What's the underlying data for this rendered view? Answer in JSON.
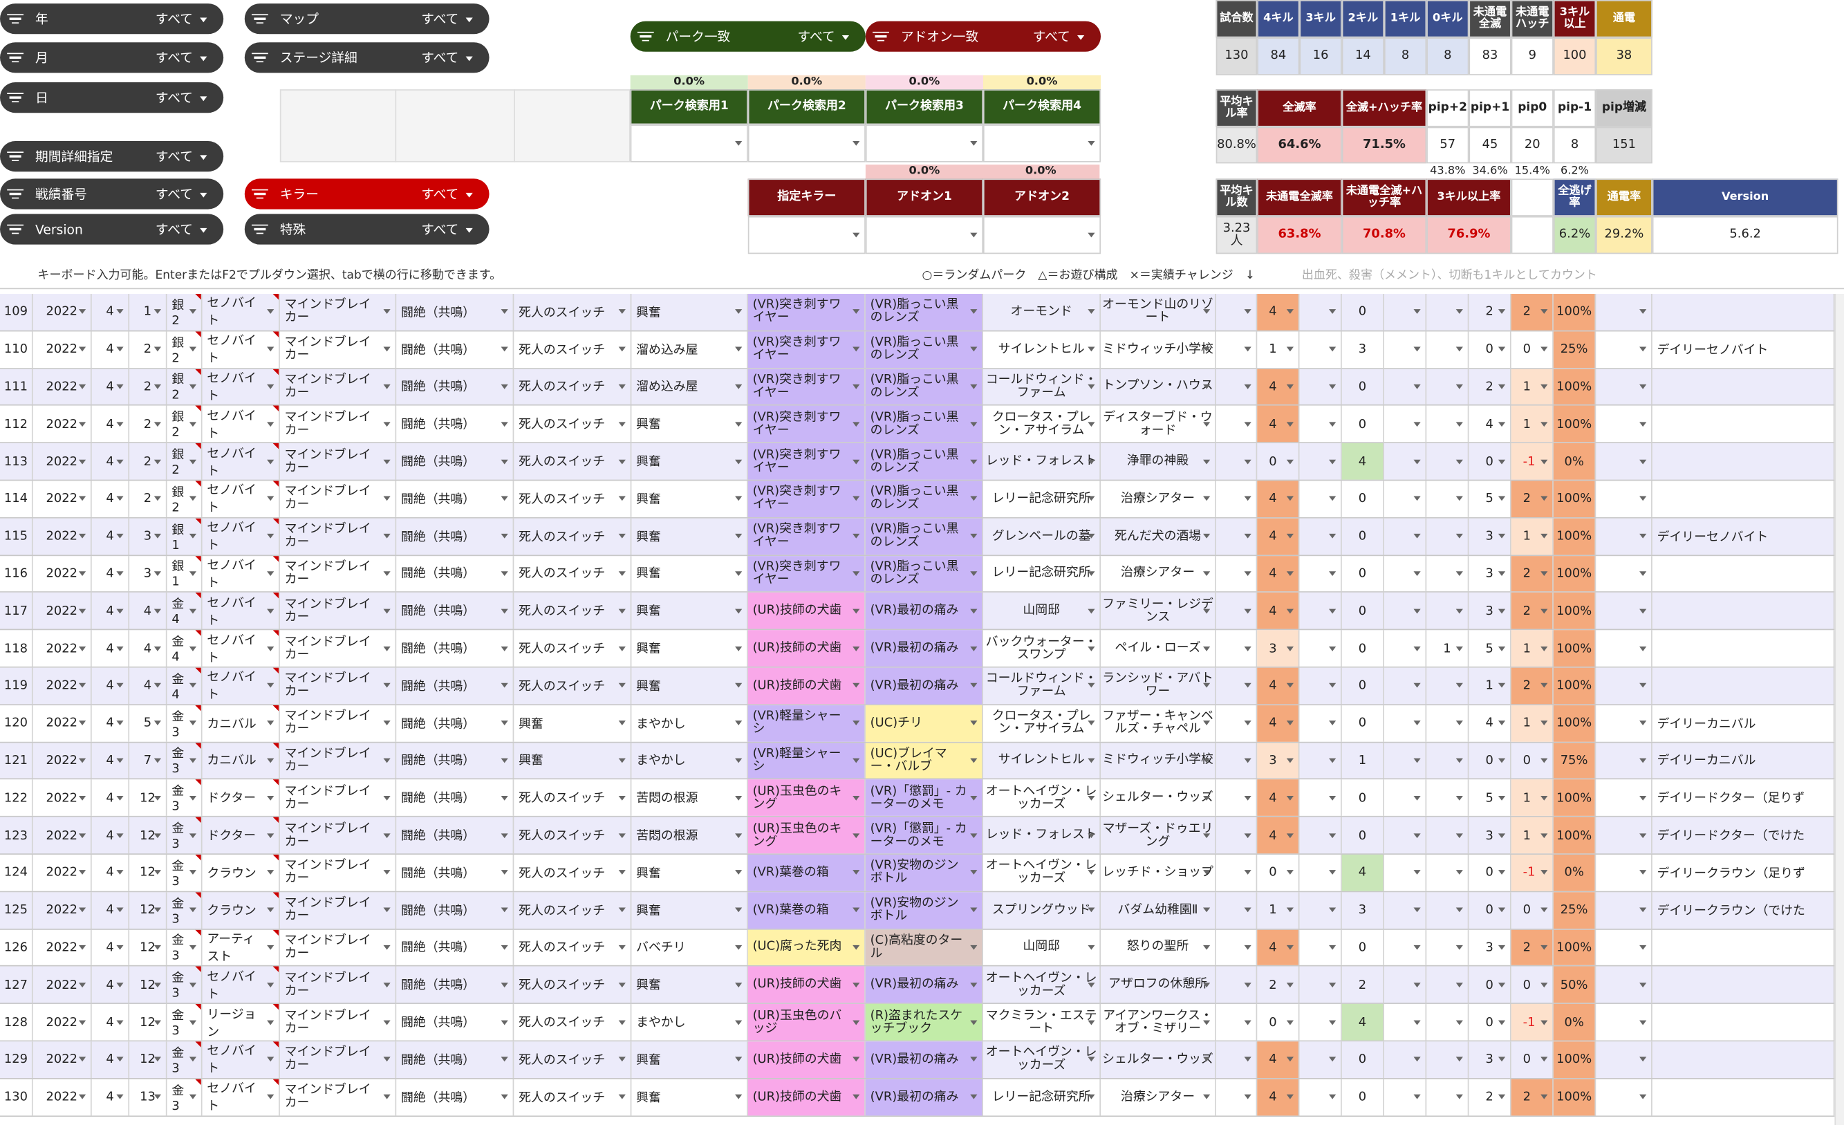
{
  "filters": {
    "year": {
      "label": "年",
      "value": "すべて"
    },
    "month": {
      "label": "月",
      "value": "すべて"
    },
    "day": {
      "label": "日",
      "value": "すべて"
    },
    "period": {
      "label": "期間詳細指定",
      "value": "すべて"
    },
    "battle_no": {
      "label": "戦績番号",
      "value": "すべて"
    },
    "version": {
      "label": "Version",
      "value": "すべて"
    },
    "map": {
      "label": "マップ",
      "value": "すべて"
    },
    "stage": {
      "label": "ステージ詳細",
      "value": "すべて"
    },
    "killer": {
      "label": "キラー",
      "value": "すべて"
    },
    "special": {
      "label": "特殊",
      "value": "すべて"
    },
    "perk_match": {
      "label": "パーク一致",
      "value": "すべて"
    },
    "addon_match": {
      "label": "アドオン一致",
      "value": "すべて"
    }
  },
  "perk_search": {
    "pcts": [
      "0.0%",
      "0.0%",
      "0.0%",
      "0.0%"
    ],
    "headers": [
      "パーク検索用1",
      "パーク検索用2",
      "パーク検索用3",
      "パーク検索用4"
    ]
  },
  "killer_search": {
    "pcts": [
      "0.0%",
      "0.0%"
    ],
    "headers": [
      "指定キラー",
      "アドオン1",
      "アドオン2"
    ]
  },
  "stats1": {
    "headers": [
      "試合数",
      "4キル",
      "3キル",
      "2キル",
      "1キル",
      "0キル",
      "未通電全滅",
      "未通電ハッチ",
      "3キル以上",
      "通電"
    ],
    "values": [
      "130",
      "84",
      "16",
      "14",
      "8",
      "8",
      "83",
      "9",
      "100",
      "38"
    ]
  },
  "stats2": {
    "headers": [
      "平均キル率",
      "全滅率",
      "全滅+ハッチ率",
      "pip+2",
      "pip+1",
      "pip0",
      "pip-1",
      "pip増減"
    ],
    "values": [
      "80.8%",
      "64.6%",
      "71.5%",
      "57",
      "45",
      "20",
      "8",
      "151"
    ],
    "sub": [
      "43.8%",
      "34.6%",
      "15.4%",
      "6.2%"
    ]
  },
  "stats3": {
    "headers": [
      "平均キル数",
      "未通電全滅率",
      "未通電全滅+ハッチ率",
      "3キル以上率",
      "",
      "全逃げ率",
      "通電率",
      "Version"
    ],
    "values": [
      "3.23人",
      "63.8%",
      "70.8%",
      "76.9%",
      "",
      "6.2%",
      "29.2%",
      "5.6.2"
    ]
  },
  "hint": "キーボード入力可能。EnterまたはF2でプルダウン選択、tabで横の行に移動できます。",
  "legend": "○＝ランダムパーク　△＝お遊び構成　×＝実績チャレンジ　↓",
  "note": "出血死、殺害（メメント）、切断も1キルとしてカウント",
  "rows": [
    {
      "n": "109",
      "y": "2022",
      "m": "4",
      "d": "1",
      "rk": "銀2",
      "k": "セノバイト",
      "p1": "マインドブレイカー",
      "p2": "闘絶（共鳴）",
      "p3": "死人のスイッチ",
      "p4": "興奮",
      "a1": "(VR)突き刺すワイヤー",
      "a1c": "lav",
      "a2": "(VR)脂っこい黒のレンズ",
      "a2c": "lav",
      "mp": "オーモンド",
      "st": "オーモンド山のリゾート",
      "k4": "4",
      "k4c": "org",
      "e": "0",
      "e2": "",
      "pp": "2",
      "pip": "2",
      "pipc": "org",
      "pct": "100%",
      "ver": ""
    },
    {
      "n": "110",
      "y": "2022",
      "m": "4",
      "d": "2",
      "rk": "銀2",
      "k": "セノバイト",
      "p1": "マインドブレイカー",
      "p2": "闘絶（共鳴）",
      "p3": "死人のスイッチ",
      "p4": "溜め込み屋",
      "a1": "(VR)突き刺すワイヤー",
      "a1c": "lav",
      "a2": "(VR)脂っこい黒のレンズ",
      "a2c": "lav",
      "mp": "サイレントヒル",
      "st": "ミドウィッチ小学校",
      "k4": "1",
      "k4c": "",
      "e": "3",
      "e2": "",
      "pp": "0",
      "pip": "0",
      "pipc": "",
      "pct": "25%",
      "ver": "デイリーセノバイト"
    },
    {
      "n": "111",
      "y": "2022",
      "m": "4",
      "d": "2",
      "rk": "銀2",
      "k": "セノバイト",
      "p1": "マインドブレイカー",
      "p2": "闘絶（共鳴）",
      "p3": "死人のスイッチ",
      "p4": "溜め込み屋",
      "a1": "(VR)突き刺すワイヤー",
      "a1c": "lav",
      "a2": "(VR)脂っこい黒のレンズ",
      "a2c": "lav",
      "mp": "コールドウィンド・ファーム",
      "st": "トンプソン・ハウス",
      "k4": "4",
      "k4c": "org",
      "e": "0",
      "e2": "",
      "pp": "2",
      "pip": "1",
      "pipc": "lorg",
      "pct": "100%",
      "ver": ""
    },
    {
      "n": "112",
      "y": "2022",
      "m": "4",
      "d": "2",
      "rk": "銀2",
      "k": "セノバイト",
      "p1": "マインドブレイカー",
      "p2": "闘絶（共鳴）",
      "p3": "死人のスイッチ",
      "p4": "興奮",
      "a1": "(VR)突き刺すワイヤー",
      "a1c": "lav",
      "a2": "(VR)脂っこい黒のレンズ",
      "a2c": "lav",
      "mp": "クロータス・プレン・アサイラム",
      "st": "ディスターブド・ウォード",
      "k4": "4",
      "k4c": "org",
      "e": "0",
      "e2": "",
      "pp": "4",
      "pip": "1",
      "pipc": "lorg",
      "pct": "100%",
      "ver": ""
    },
    {
      "n": "113",
      "y": "2022",
      "m": "4",
      "d": "2",
      "rk": "銀2",
      "k": "セノバイト",
      "p1": "マインドブレイカー",
      "p2": "闘絶（共鳴）",
      "p3": "死人のスイッチ",
      "p4": "興奮",
      "a1": "(VR)突き刺すワイヤー",
      "a1c": "lav",
      "a2": "(VR)脂っこい黒のレンズ",
      "a2c": "lav",
      "mp": "レッド・フォレスト",
      "st": "浄罪の神殿",
      "k4": "0",
      "k4c": "",
      "e": "4",
      "e2": "lgrn",
      "pp": "0",
      "pip": "-1",
      "pipc": "lorg rn",
      "pct": "0%",
      "ver": ""
    },
    {
      "n": "114",
      "y": "2022",
      "m": "4",
      "d": "2",
      "rk": "銀2",
      "k": "セノバイト",
      "p1": "マインドブレイカー",
      "p2": "闘絶（共鳴）",
      "p3": "死人のスイッチ",
      "p4": "興奮",
      "a1": "(VR)突き刺すワイヤー",
      "a1c": "lav",
      "a2": "(VR)脂っこい黒のレンズ",
      "a2c": "lav",
      "mp": "レリー記念研究所",
      "st": "治療シアター",
      "k4": "4",
      "k4c": "org",
      "e": "0",
      "e2": "",
      "pp": "5",
      "pip": "2",
      "pipc": "org",
      "pct": "100%",
      "ver": ""
    },
    {
      "n": "115",
      "y": "2022",
      "m": "4",
      "d": "3",
      "rk": "銀1",
      "k": "セノバイト",
      "p1": "マインドブレイカー",
      "p2": "闘絶（共鳴）",
      "p3": "死人のスイッチ",
      "p4": "興奮",
      "a1": "(VR)突き刺すワイヤー",
      "a1c": "lav",
      "a2": "(VR)脂っこい黒のレンズ",
      "a2c": "lav",
      "mp": "グレンベールの墓",
      "st": "死んだ犬の酒場",
      "k4": "4",
      "k4c": "org",
      "e": "0",
      "e2": "",
      "pp": "3",
      "pip": "1",
      "pipc": "lorg",
      "pct": "100%",
      "ver": "デイリーセノバイト"
    },
    {
      "n": "116",
      "y": "2022",
      "m": "4",
      "d": "3",
      "rk": "銀1",
      "k": "セノバイト",
      "p1": "マインドブレイカー",
      "p2": "闘絶（共鳴）",
      "p3": "死人のスイッチ",
      "p4": "興奮",
      "a1": "(VR)突き刺すワイヤー",
      "a1c": "lav",
      "a2": "(VR)脂っこい黒のレンズ",
      "a2c": "lav",
      "mp": "レリー記念研究所",
      "st": "治療シアター",
      "k4": "4",
      "k4c": "org",
      "e": "0",
      "e2": "",
      "pp": "3",
      "pip": "2",
      "pipc": "org",
      "pct": "100%",
      "ver": ""
    },
    {
      "n": "117",
      "y": "2022",
      "m": "4",
      "d": "4",
      "rk": "金4",
      "k": "セノバイト",
      "p1": "マインドブレイカー",
      "p2": "闘絶（共鳴）",
      "p3": "死人のスイッチ",
      "p4": "興奮",
      "a1": "(UR)技師の犬歯",
      "a1c": "pink",
      "a2": "(VR)最初の痛み",
      "a2c": "lav",
      "mp": "山岡邸",
      "st": "ファミリー・レジデンス",
      "k4": "4",
      "k4c": "org",
      "e": "0",
      "e2": "",
      "pp": "3",
      "pip": "2",
      "pipc": "org",
      "pct": "100%",
      "ver": ""
    },
    {
      "n": "118",
      "y": "2022",
      "m": "4",
      "d": "4",
      "rk": "金4",
      "k": "セノバイト",
      "p1": "マインドブレイカー",
      "p2": "闘絶（共鳴）",
      "p3": "死人のスイッチ",
      "p4": "興奮",
      "a1": "(UR)技師の犬歯",
      "a1c": "pink",
      "a2": "(VR)最初の痛み",
      "a2c": "lav",
      "mp": "バックウォーター・スワンプ",
      "st": "ペイル・ローズ",
      "k4": "3",
      "k4c": "lorg",
      "e": "0",
      "e2": "",
      "e3": "1",
      "pp": "5",
      "pip": "1",
      "pipc": "lorg",
      "pct": "100%",
      "ver": ""
    },
    {
      "n": "119",
      "y": "2022",
      "m": "4",
      "d": "4",
      "rk": "金4",
      "k": "セノバイト",
      "p1": "マインドブレイカー",
      "p2": "闘絶（共鳴）",
      "p3": "死人のスイッチ",
      "p4": "興奮",
      "a1": "(UR)技師の犬歯",
      "a1c": "pink",
      "a2": "(VR)最初の痛み",
      "a2c": "lav",
      "mp": "コールドウィンド・ファーム",
      "st": "ランシッド・アバトワー",
      "k4": "4",
      "k4c": "org",
      "e": "0",
      "e2": "",
      "pp": "1",
      "pip": "2",
      "pipc": "org",
      "pct": "100%",
      "ver": ""
    },
    {
      "n": "120",
      "y": "2022",
      "m": "4",
      "d": "5",
      "rk": "金3",
      "k": "カニバル",
      "p1": "マインドブレイカー",
      "p2": "闘絶（共鳴）",
      "p3": "興奮",
      "p4": "まやかし",
      "a1": "(VR)軽量シャーシ",
      "a1c": "lav",
      "a2": "(UC)チリ",
      "a2c": "ylw",
      "mp": "クロータス・プレン・アサイラム",
      "st": "ファザー・キャンベルズ・チャペル",
      "k4": "4",
      "k4c": "org",
      "e": "0",
      "e2": "",
      "pp": "4",
      "pip": "1",
      "pipc": "lorg",
      "pct": "100%",
      "ver": "デイリーカニバル"
    },
    {
      "n": "121",
      "y": "2022",
      "m": "4",
      "d": "7",
      "rk": "金3",
      "k": "カニバル",
      "p1": "マインドブレイカー",
      "p2": "闘絶（共鳴）",
      "p3": "興奮",
      "p4": "まやかし",
      "a1": "(VR)軽量シャーシ",
      "a1c": "lav",
      "a2": "(UC)ブレイマー・バルブ",
      "a2c": "ylw",
      "mp": "サイレントヒル",
      "st": "ミドウィッチ小学校",
      "k4": "3",
      "k4c": "lorg",
      "e": "1",
      "e2": "",
      "pp": "0",
      "pip": "0",
      "pipc": "",
      "pct": "75%",
      "ver": "デイリーカニバル"
    },
    {
      "n": "122",
      "y": "2022",
      "m": "4",
      "d": "12",
      "rk": "金3",
      "k": "ドクター",
      "p1": "マインドブレイカー",
      "p2": "闘絶（共鳴）",
      "p3": "死人のスイッチ",
      "p4": "苦悶の根源",
      "a1": "(UR)玉虫色のキング",
      "a1c": "pink",
      "a2": "(VR)「懲罰」- カーターのメモ",
      "a2c": "lav",
      "mp": "オートヘイヴン・レッカーズ",
      "st": "シェルター・ウッズ",
      "k4": "4",
      "k4c": "org",
      "e": "0",
      "e2": "",
      "pp": "5",
      "pip": "1",
      "pipc": "lorg",
      "pct": "100%",
      "ver": "デイリードクター（足りず"
    },
    {
      "n": "123",
      "y": "2022",
      "m": "4",
      "d": "12",
      "rk": "金3",
      "k": "ドクター",
      "p1": "マインドブレイカー",
      "p2": "闘絶（共鳴）",
      "p3": "死人のスイッチ",
      "p4": "苦悶の根源",
      "a1": "(UR)玉虫色のキング",
      "a1c": "pink",
      "a2": "(VR)「懲罰」- カーターのメモ",
      "a2c": "lav",
      "mp": "レッド・フォレスト",
      "st": "マザーズ・ドゥエリング",
      "k4": "4",
      "k4c": "org",
      "e": "0",
      "e2": "",
      "pp": "3",
      "pip": "1",
      "pipc": "lorg",
      "pct": "100%",
      "ver": "デイリードクター（でけた"
    },
    {
      "n": "124",
      "y": "2022",
      "m": "4",
      "d": "12",
      "rk": "金3",
      "k": "クラウン",
      "p1": "マインドブレイカー",
      "p2": "闘絶（共鳴）",
      "p3": "死人のスイッチ",
      "p4": "興奮",
      "a1": "(VR)葉巻の箱",
      "a1c": "lav",
      "a2": "(VR)安物のジンボトル",
      "a2c": "lav",
      "mp": "オートヘイヴン・レッカーズ",
      "st": "レッチド・ショップ",
      "k4": "0",
      "k4c": "",
      "e": "4",
      "e2": "lgrn",
      "pp": "0",
      "pip": "-1",
      "pipc": "lorg rn",
      "pct": "0%",
      "ver": "デイリークラウン（足りず"
    },
    {
      "n": "125",
      "y": "2022",
      "m": "4",
      "d": "12",
      "rk": "金3",
      "k": "クラウン",
      "p1": "マインドブレイカー",
      "p2": "闘絶（共鳴）",
      "p3": "死人のスイッチ",
      "p4": "興奮",
      "a1": "(VR)葉巻の箱",
      "a1c": "lav",
      "a2": "(VR)安物のジンボトル",
      "a2c": "lav",
      "mp": "スプリングウッド",
      "st": "バダム幼稚園Ⅱ",
      "k4": "1",
      "k4c": "",
      "e": "3",
      "e2": "",
      "pp": "0",
      "pip": "0",
      "pipc": "",
      "pct": "25%",
      "ver": "デイリークラウン（でけた"
    },
    {
      "n": "126",
      "y": "2022",
      "m": "4",
      "d": "12",
      "rk": "金3",
      "k": "アーティスト",
      "p1": "マインドブレイカー",
      "p2": "闘絶（共鳴）",
      "p3": "死人のスイッチ",
      "p4": "バベチリ",
      "a1": "(UC)腐った死肉",
      "a1c": "ylw",
      "a2": "(C)高粘度のタール",
      "a2c": "tan",
      "mp": "山岡邸",
      "st": "怒りの聖所",
      "k4": "4",
      "k4c": "org",
      "e": "0",
      "e2": "",
      "pp": "3",
      "pip": "2",
      "pipc": "org",
      "pct": "100%",
      "ver": ""
    },
    {
      "n": "127",
      "y": "2022",
      "m": "4",
      "d": "12",
      "rk": "金3",
      "k": "セノバイト",
      "p1": "マインドブレイカー",
      "p2": "闘絶（共鳴）",
      "p3": "死人のスイッチ",
      "p4": "興奮",
      "a1": "(UR)技師の犬歯",
      "a1c": "pink",
      "a2": "(VR)最初の痛み",
      "a2c": "lav",
      "mp": "オートヘイヴン・レッカーズ",
      "st": "アザロフの休憩所",
      "k4": "2",
      "k4c": "",
      "e": "2",
      "e2": "",
      "pp": "0",
      "pip": "0",
      "pipc": "",
      "pct": "50%",
      "ver": ""
    },
    {
      "n": "128",
      "y": "2022",
      "m": "4",
      "d": "12",
      "rk": "金3",
      "k": "リージョン",
      "p1": "マインドブレイカー",
      "p2": "闘絶（共鳴）",
      "p3": "死人のスイッチ",
      "p4": "まやかし",
      "a1": "(UR)玉虫色のバッジ",
      "a1c": "pink",
      "a2": "(R)盗まれたスケッチブック",
      "a2c": "grn",
      "mp": "マクミラン・エステート",
      "st": "アイアンワークス・オブ・ミザリー",
      "k4": "0",
      "k4c": "",
      "e": "4",
      "e2": "lgrn",
      "pp": "0",
      "pip": "-1",
      "pipc": "lorg rn",
      "pct": "0%",
      "ver": ""
    },
    {
      "n": "129",
      "y": "2022",
      "m": "4",
      "d": "12",
      "rk": "金3",
      "k": "セノバイト",
      "p1": "マインドブレイカー",
      "p2": "闘絶（共鳴）",
      "p3": "死人のスイッチ",
      "p4": "興奮",
      "a1": "(UR)技師の犬歯",
      "a1c": "pink",
      "a2": "(VR)最初の痛み",
      "a2c": "lav",
      "mp": "オートヘイヴン・レッカーズ",
      "st": "シェルター・ウッズ",
      "k4": "4",
      "k4c": "org",
      "e": "0",
      "e2": "",
      "pp": "3",
      "pip": "0",
      "pipc": "",
      "pct": "100%",
      "ver": ""
    },
    {
      "n": "130",
      "y": "2022",
      "m": "4",
      "d": "13",
      "rk": "金3",
      "k": "セノバイト",
      "p1": "マインドブレイカー",
      "p2": "闘絶（共鳴）",
      "p3": "死人のスイッチ",
      "p4": "興奮",
      "a1": "(UR)技師の犬歯",
      "a1c": "pink",
      "a2": "(VR)最初の痛み",
      "a2c": "lav",
      "mp": "レリー記念研究所",
      "st": "治療シアター",
      "k4": "4",
      "k4c": "org",
      "e": "0",
      "e2": "",
      "pp": "2",
      "pip": "2",
      "pipc": "org",
      "pct": "100%",
      "ver": ""
    }
  ],
  "colors": {
    "perk_header": "#2f5a1a",
    "addon_header": "#7b0f12",
    "kill_header": "#3b4f8e",
    "pink": "#f9a8e9",
    "lavender": "#c9b6f7",
    "orange": "#f4a97c"
  }
}
